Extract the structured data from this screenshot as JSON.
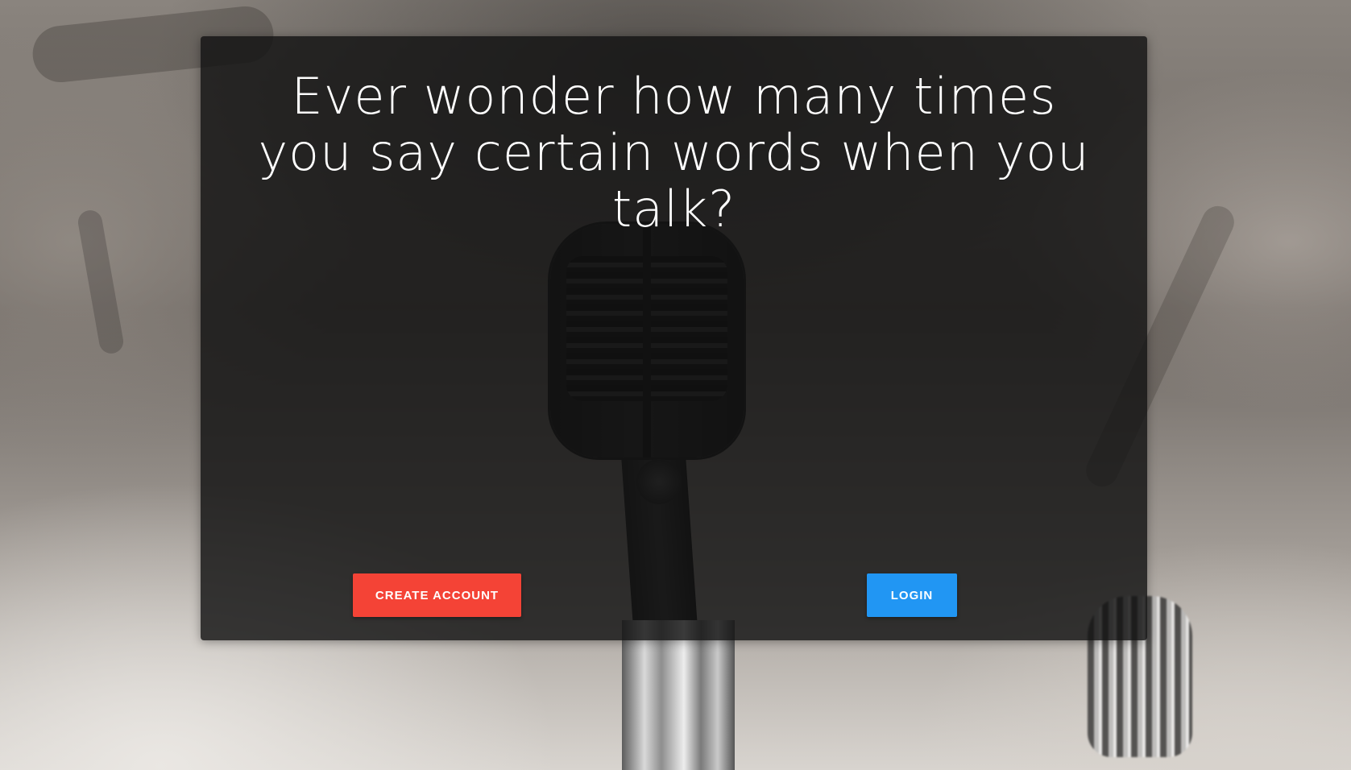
{
  "hero": {
    "headline": "Ever wonder how many times you say certain words when you talk?"
  },
  "actions": {
    "create_account_label": "CREATE ACCOUNT",
    "login_label": "LOGIN"
  },
  "colors": {
    "create_account_bg": "#f44336",
    "login_bg": "#2196f3",
    "card_overlay": "#121212"
  },
  "background": {
    "image_subject": "vintage-microphone-photo"
  }
}
